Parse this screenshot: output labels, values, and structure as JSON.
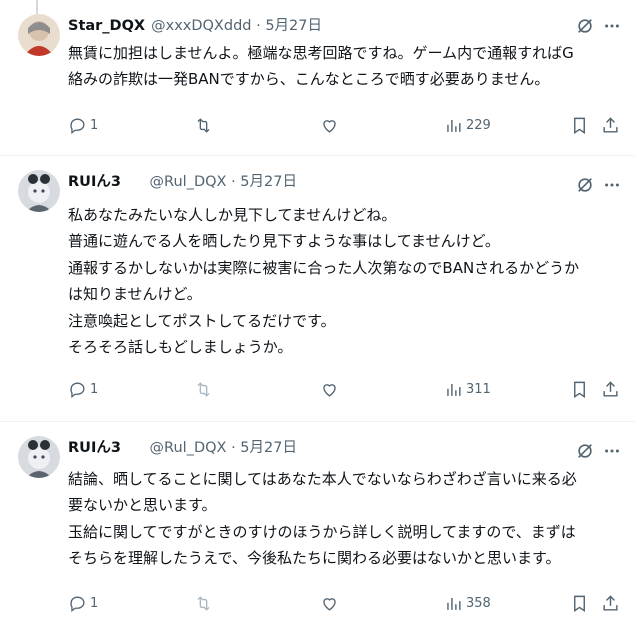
{
  "tweets": [
    {
      "name": "Star_DQX",
      "handle": "@xxxDQXddd",
      "sep": "·",
      "date": "5月27日",
      "lines": [
        "無賃に加担はしませんよ。極端な思考回路ですね。ゲーム内で通報すればG",
        "絡みの詐欺は一発BANですから、こんなところで晒す必要ありません。"
      ],
      "replies": "1",
      "retweets": "",
      "likes": "",
      "views": "229",
      "avatar_color": "#c98c6c"
    },
    {
      "name": "RUIん3",
      "handle": "@Rul_DQX",
      "sep": "·",
      "date": "5月27日",
      "lines": [
        "私あなたみたいな人しか見下してませんけどね。",
        "普通に遊んでる人を晒したり見下すような事はしてませんけど。",
        "通報するかしないかは実際に被害に合った人次第なのでBANされるかどうか",
        "は知りませんけど。",
        "注意喚起としてポストしてるだけです。",
        "そろそろ話しもどしましょうか。"
      ],
      "replies": "1",
      "retweets": "",
      "likes": "",
      "views": "311",
      "avatar_color": "#9aa0aa"
    },
    {
      "name": "RUIん3",
      "handle": "@Rul_DQX",
      "sep": "·",
      "date": "5月27日",
      "lines": [
        "結論、晒してることに関してはあなた本人でないならわざわざ言いに来る必",
        "要ないかと思います。",
        "玉給に関してですがときのすけのほうから詳しく説明してますので、まずは",
        "そちらを理解したうえで、今後私たちに関わる必要はないかと思います。"
      ],
      "replies": "1",
      "retweets": "",
      "likes": "",
      "views": "358",
      "avatar_color": "#9aa0aa"
    }
  ],
  "colors": {
    "text": "#0f1419",
    "muted": "#536471",
    "divider": "#eff3f4"
  }
}
